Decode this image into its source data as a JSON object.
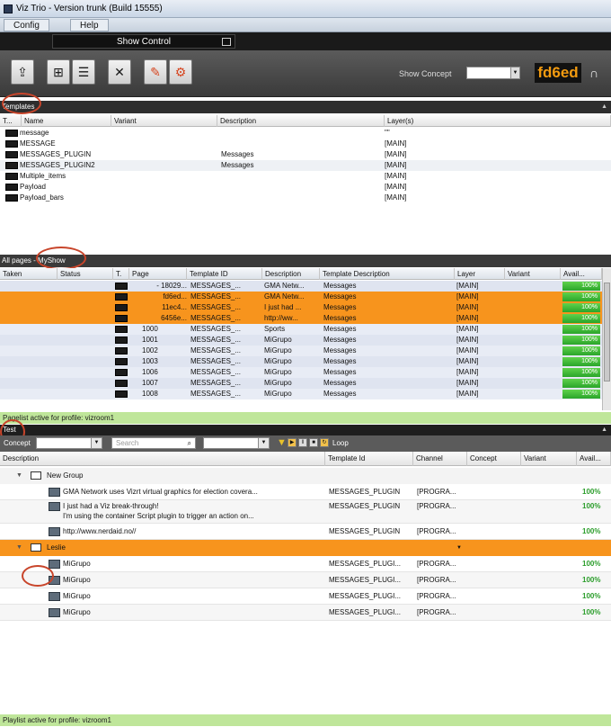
{
  "window": {
    "title": "Viz Trio - Version trunk (Build 15555)"
  },
  "menu": {
    "config": "Config",
    "help": "Help"
  },
  "show_control": {
    "label": "Show Control"
  },
  "toolbar": {
    "buttons": [
      "import-icon",
      "add-page-icon",
      "add-list-icon",
      "tools-icon",
      "edit-icon",
      "settings-icon"
    ],
    "show_concept_label": "Show Concept",
    "show_concept_value": "",
    "profile_code": "fd6ed"
  },
  "templates": {
    "header": "Templates",
    "columns": [
      "T...",
      "Name",
      "Variant",
      "Description",
      "Layer(s)"
    ],
    "rows": [
      {
        "name": "message",
        "variant": "",
        "description": "",
        "layers": "\"\""
      },
      {
        "name": "MESSAGE",
        "variant": "",
        "description": "",
        "layers": "[MAIN]"
      },
      {
        "name": "MESSAGES_PLUGIN",
        "variant": "",
        "description": "Messages",
        "layers": "[MAIN]"
      },
      {
        "name": "MESSAGES_PLUGIN2",
        "variant": "",
        "description": "Messages",
        "layers": "[MAIN]"
      },
      {
        "name": "Multiple_items",
        "variant": "",
        "description": "",
        "layers": "[MAIN]"
      },
      {
        "name": "Payload",
        "variant": "",
        "description": "",
        "layers": "[MAIN]"
      },
      {
        "name": "Payload_bars",
        "variant": "",
        "description": "",
        "layers": "[MAIN]"
      }
    ]
  },
  "pages": {
    "header_prefix": "All pages - ",
    "header_show": "MyShow",
    "columns": [
      "Taken",
      "Status",
      "T.",
      "Page",
      "Template ID",
      "Description",
      "Template Description",
      "Layer",
      "Variant",
      "Avail..."
    ],
    "rows": [
      {
        "page": "- 18029...",
        "template_id": "MESSAGES_...",
        "description": "GMA Netw...",
        "template_description": "Messages",
        "layer": "[MAIN]",
        "avail": "100%",
        "highlight": false
      },
      {
        "page": "fd6ed...",
        "template_id": "MESSAGES_...",
        "description": "GMA Netw...",
        "template_description": "Messages",
        "layer": "[MAIN]",
        "avail": "100%",
        "highlight": true
      },
      {
        "page": "11ec4...",
        "template_id": "MESSAGES_...",
        "description": "I just had ...",
        "template_description": "Messages",
        "layer": "[MAIN]",
        "avail": "100%",
        "highlight": true
      },
      {
        "page": "6456e...",
        "template_id": "MESSAGES_...",
        "description": "http://ww...",
        "template_description": "Messages",
        "layer": "[MAIN]",
        "avail": "100%",
        "highlight": true
      },
      {
        "page": "1000",
        "template_id": "MESSAGES_...",
        "description": "Sports",
        "template_description": "Messages",
        "layer": "[MAIN]",
        "avail": "100%",
        "highlight": false
      },
      {
        "page": "1001",
        "template_id": "MESSAGES_...",
        "description": "MiGrupo",
        "template_description": "Messages",
        "layer": "[MAIN]",
        "avail": "100%",
        "highlight": false
      },
      {
        "page": "1002",
        "template_id": "MESSAGES_...",
        "description": "MiGrupo",
        "template_description": "Messages",
        "layer": "[MAIN]",
        "avail": "100%",
        "highlight": false
      },
      {
        "page": "1003",
        "template_id": "MESSAGES_...",
        "description": "MiGrupo",
        "template_description": "Messages",
        "layer": "[MAIN]",
        "avail": "100%",
        "highlight": false
      },
      {
        "page": "1006",
        "template_id": "MESSAGES_...",
        "description": "MiGrupo",
        "template_description": "Messages",
        "layer": "[MAIN]",
        "avail": "100%",
        "highlight": false
      },
      {
        "page": "1007",
        "template_id": "MESSAGES_...",
        "description": "MiGrupo",
        "template_description": "Messages",
        "layer": "[MAIN]",
        "avail": "100%",
        "highlight": false
      },
      {
        "page": "1008",
        "template_id": "MESSAGES_...",
        "description": "MiGrupo",
        "template_description": "Messages",
        "layer": "[MAIN]",
        "avail": "100%",
        "highlight": false
      }
    ],
    "status": "Pagelist active for profile: vizroom1"
  },
  "test": {
    "header": "Test",
    "concept_label": "Concept",
    "search_placeholder": "Search",
    "loop_label": "Loop",
    "columns": [
      "Description",
      "Template Id",
      "Channel",
      "Concept",
      "Variant",
      "Avail..."
    ],
    "groups": [
      {
        "name": "New Group",
        "items": [
          {
            "line1": "GMA Network uses Vizrt virtual graphics for election covera...",
            "line2": "",
            "template_id": "MESSAGES_PLUGIN",
            "channel": "[PROGRA...",
            "avail": "100%"
          },
          {
            "line1": "I just had a Viz break-through!",
            "line2": "I'm using the container Script plugin to trigger an action on...",
            "template_id": "MESSAGES_PLUGIN",
            "channel": "[PROGRA...",
            "avail": "100%"
          },
          {
            "line1": "http://www.nerdaid.no//",
            "line2": "",
            "template_id": "MESSAGES_PLUGIN",
            "channel": "[PROGRA...",
            "avail": "100%"
          }
        ]
      },
      {
        "name": "Leslie",
        "items": [
          {
            "line1": "MiGrupo",
            "line2": "",
            "template_id": "MESSAGES_PLUGI...",
            "channel": "[PROGRA...",
            "avail": "100%"
          },
          {
            "line1": "MiGrupo",
            "line2": "",
            "template_id": "MESSAGES_PLUGI...",
            "channel": "[PROGRA...",
            "avail": "100%"
          },
          {
            "line1": "MiGrupo",
            "line2": "",
            "template_id": "MESSAGES_PLUGI...",
            "channel": "[PROGRA...",
            "avail": "100%"
          },
          {
            "line1": "MiGrupo",
            "line2": "",
            "template_id": "MESSAGES_PLUGI...",
            "channel": "[PROGRA...",
            "avail": "100%"
          }
        ]
      }
    ],
    "status": "Playlist active for profile: vizroom1"
  },
  "colors": {
    "highlight": "#f7941d",
    "avail_green": "#3cb53c",
    "status_green": "#bfe69a",
    "profile_orange": "#f39b10",
    "annotation_red": "#c8452b"
  }
}
